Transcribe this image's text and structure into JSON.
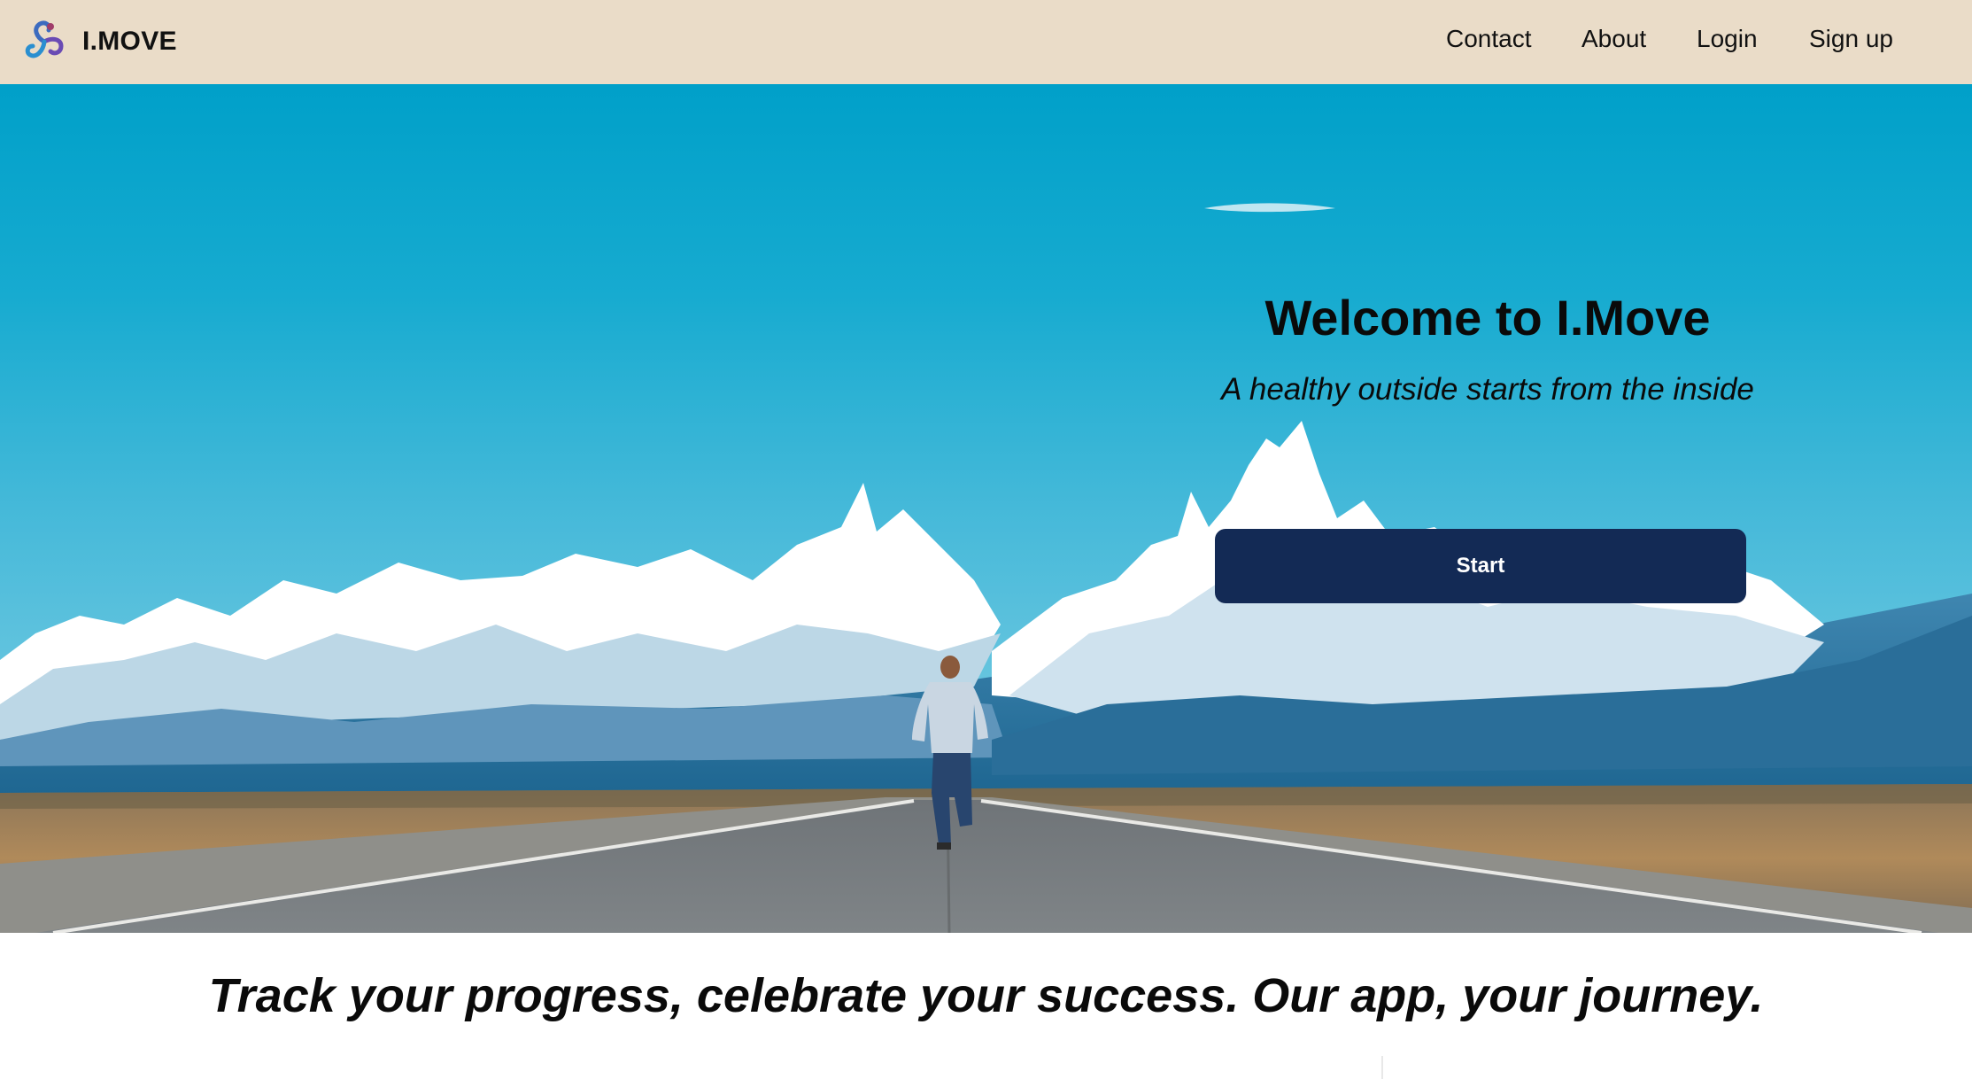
{
  "brand": {
    "name": "I.MOVE",
    "logo_icon": "swirl-logo-icon"
  },
  "nav": {
    "items": [
      {
        "label": "Contact"
      },
      {
        "label": "About"
      },
      {
        "label": "Login"
      },
      {
        "label": "Sign up"
      }
    ]
  },
  "hero": {
    "title": "Welcome to I.Move",
    "subtitle": "A healthy outside starts from the inside",
    "start_label": "Start",
    "image": "runner on road toward snowy mountains"
  },
  "tagline": "Track your progress, celebrate your success. Our app, your journey.",
  "colors": {
    "navbar_bg": "#eadcc8",
    "button_bg": "#132a55",
    "button_text": "#ffffff",
    "sky": "#00a0c9"
  }
}
